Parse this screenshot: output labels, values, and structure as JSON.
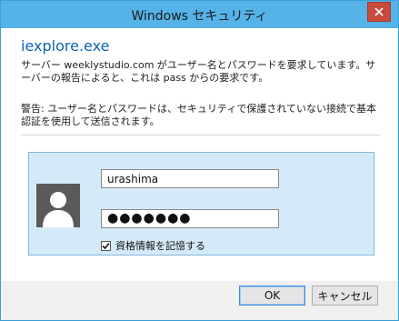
{
  "window": {
    "title": "Windows セキュリティ"
  },
  "dialog": {
    "app_name": "iexplore.exe",
    "message": "サーバー weeklystudio.com がユーザー名とパスワードを要求しています。サーバーの報告によると、これは pass からの要求です。",
    "warning": "警告: ユーザー名とパスワードは、セキュリティで保護されていない接続で基本認証を使用して送信されます。"
  },
  "credentials": {
    "username": "urashima",
    "password_mask": "●●●●●●●",
    "remember_label": "資格情報を記憶する",
    "remember_checked": true
  },
  "buttons": {
    "ok": "OK",
    "cancel": "キャンセル"
  },
  "icons": {
    "close": "close-icon",
    "avatar": "user-avatar-icon",
    "check": "check-icon"
  },
  "colors": {
    "titlebar": "#55b3e8",
    "accent_text": "#0a63b5",
    "panel": "#d5eaf8",
    "close": "#c74a3c"
  }
}
